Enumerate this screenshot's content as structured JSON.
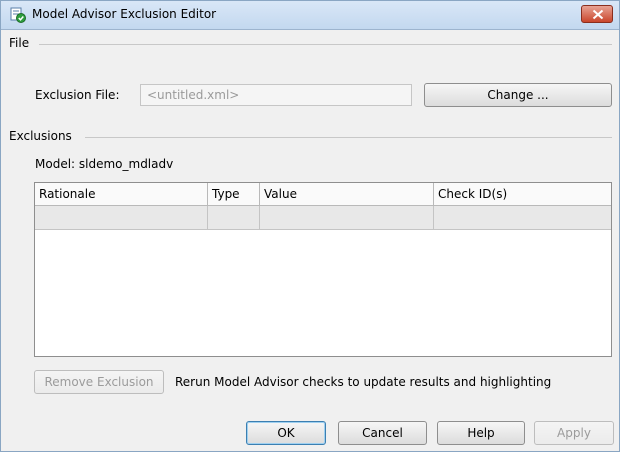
{
  "window": {
    "title": "Model Advisor Exclusion Editor",
    "app_icon": "model-advisor-icon",
    "close_icon": "close-icon"
  },
  "file_section": {
    "label": "File",
    "exclusion_file_label": "Exclusion File:",
    "exclusion_file_value": "<untitled.xml>",
    "change_button": "Change ..."
  },
  "exclusions_section": {
    "label": "Exclusions",
    "model_label": "Model: sldemo_mdladv",
    "table": {
      "columns": [
        "Rationale",
        "Type",
        "Value",
        "Check ID(s)"
      ],
      "rows": [
        [
          "",
          "",
          "",
          ""
        ]
      ]
    },
    "remove_button": "Remove Exclusion",
    "rerun_note": "Rerun Model Advisor checks to update results and highlighting"
  },
  "footer": {
    "ok": "OK",
    "cancel": "Cancel",
    "help": "Help",
    "apply": "Apply"
  },
  "colors": {
    "title_bar": "#c9dcf1",
    "close_button": "#c9462c",
    "default_button_border": "#3c7fb1",
    "disabled_text": "#9b9b9b"
  }
}
